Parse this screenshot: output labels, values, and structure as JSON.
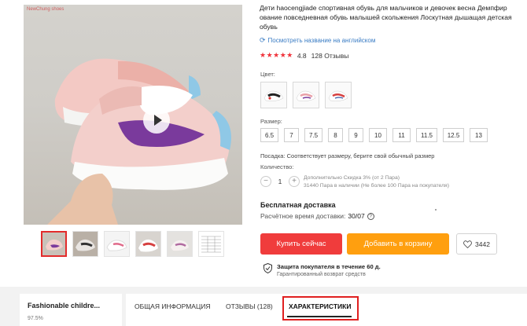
{
  "gallery": {
    "watermark": "NewChung shoes",
    "thumbnail_count": 6
  },
  "product": {
    "title": "Дети haocengjiade спортивная обувь для мальчиков и девочек весна Демпфир ование повседневная обувь малышей скольжения Лоскутная дышащая детская обувь",
    "translate_link": "Посмотреть название на английском",
    "stars": "★★★★★",
    "rating_value": "4.8",
    "reviews": "128 Отзывы"
  },
  "options": {
    "color_label": "Цвет:",
    "size_label": "Размер:",
    "sizes": [
      "6.5",
      "7",
      "7.5",
      "8",
      "9",
      "10",
      "11",
      "11.5",
      "12.5",
      "13"
    ],
    "fit_note": "Посадка: Соответствует размеру, берите свой обычный размер",
    "qty_label": "Количество:",
    "qty_minus": "−",
    "qty_value": "1",
    "qty_plus": "+",
    "discount_note": "Дополнительно Скидка 3% (от 2 Пара)",
    "stock_note": "31440 Пара в наличии (Не более 100 Пара на покупателя)"
  },
  "shipping": {
    "title": "Бесплатная доставка",
    "time_label": "Расчётное время доставки:",
    "time_value": "30/07",
    "help_icon": "?"
  },
  "actions": {
    "buy_now": "Купить сейчас",
    "add_to_cart": "Добавить в корзину",
    "wishlist_count": "3442"
  },
  "protection": {
    "title": "Защита покупателя в течение 60 д.",
    "subtitle": "Гарантированный возврат средств"
  },
  "store": {
    "name": "Fashionable childre...",
    "rating": "97.5%"
  },
  "tabs": [
    {
      "label": "ОБЩАЯ ИНФОРМАЦИЯ"
    },
    {
      "label": "ОТЗЫВЫ (128)"
    },
    {
      "label": "ХАРАКТЕРИСТИКИ"
    }
  ],
  "colors": {
    "buy": "#f03c3c",
    "cart": "#ff9f0f",
    "star": "#f0333b",
    "highlight": "#e02020",
    "link": "#3a7cc4"
  }
}
